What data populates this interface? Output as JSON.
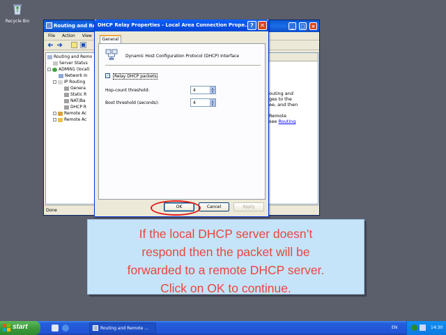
{
  "desktop": {
    "recycle_bin_label": "Recycle Bin"
  },
  "mmc": {
    "title": "Routing and Remo",
    "menu": [
      "File",
      "Action",
      "View"
    ],
    "tree": [
      "Routing and Remo",
      "Server Status",
      "ADMIN1 (local)",
      "Network In",
      "IP Routing",
      "Genera",
      "Static R",
      "NAT/Ba",
      "DHCP R",
      "Remote Ac",
      "Remote Ac"
    ],
    "right_text": [
      "outing and",
      "ges to the",
      "ee, and then",
      "",
      "Remote",
      "see "
    ],
    "right_link": "Routing",
    "status": "Done"
  },
  "dialog": {
    "title": "DHCP Relay Properties - Local Area Connection Prope...",
    "tab": "General",
    "interface_name": "Dynamic Host Configuration Protocol (DHCP) Interface",
    "relay_label": "Relay DHCP packets",
    "relay_checked": true,
    "hop_label": "Hop-count threshold:",
    "hop_value": "4",
    "boot_label": "Boot threshold (seconds):",
    "boot_value": "4",
    "ok": "OK",
    "cancel": "Cancel",
    "apply": "Apply",
    "help_symbol": "?",
    "close_symbol": "✕"
  },
  "callout": {
    "lines": [
      "If the local DHCP server doesn’t",
      "respond then the packet will be",
      "forwarded to a remote DHCP server.",
      "Click on OK to continue."
    ],
    "text_color": "#e8463c",
    "bg_color": "#c5e4fa"
  },
  "taskbar": {
    "start": "start",
    "task": "Routing and Remote ...",
    "lang": "EN",
    "clock": "14:30"
  },
  "colors": {
    "desktop": "#5b5e6b",
    "highlight_ring": "#e21717"
  }
}
